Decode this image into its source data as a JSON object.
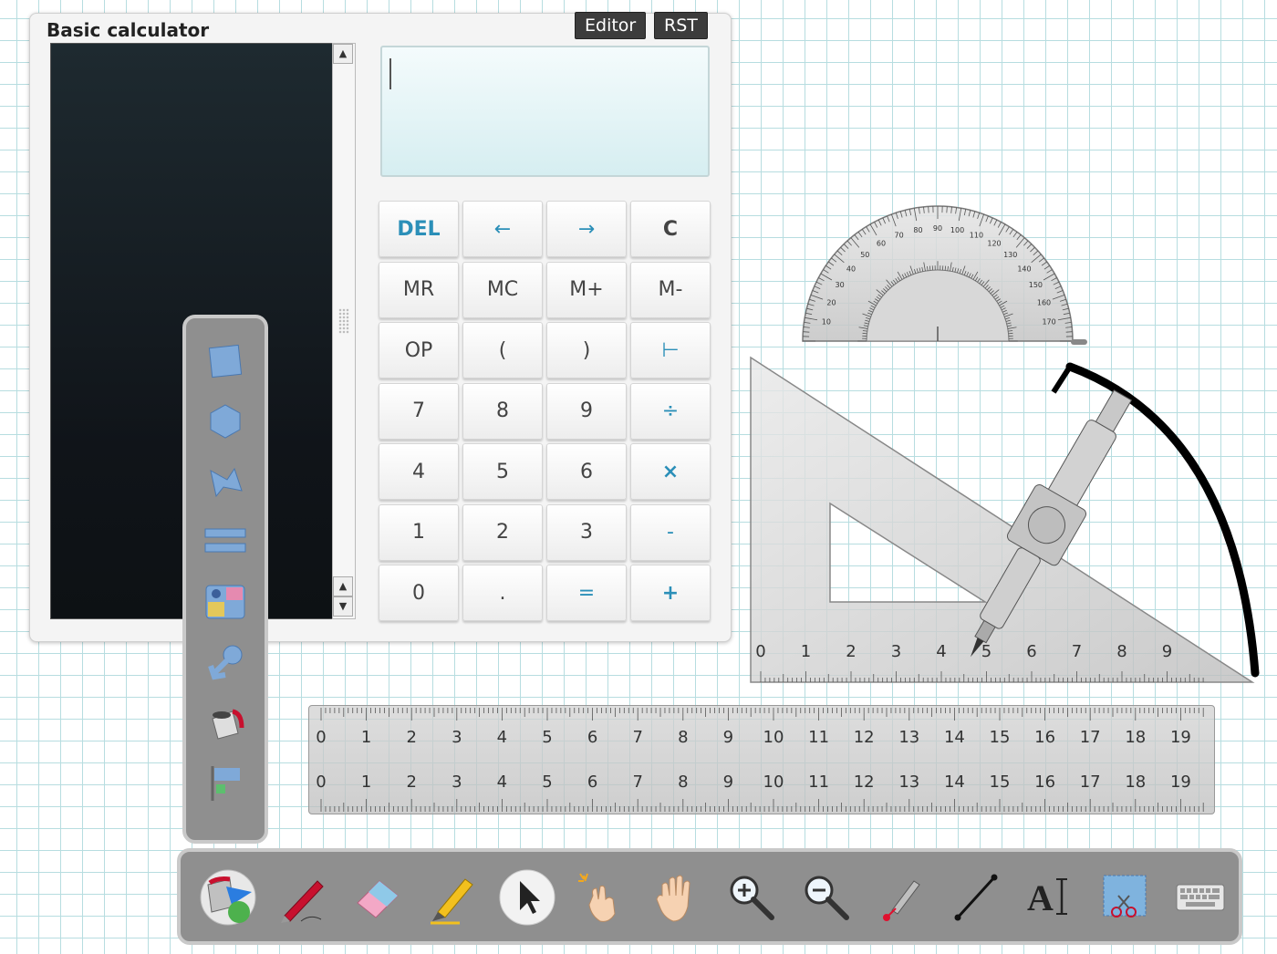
{
  "calculator": {
    "title": "Basic calculator",
    "editor_button": "Editor",
    "rst_button": "RST",
    "keys": [
      {
        "label": "DEL",
        "style": "accent bold"
      },
      {
        "label": "←",
        "style": "accent"
      },
      {
        "label": "→",
        "style": "accent"
      },
      {
        "label": "C",
        "style": "bold"
      },
      {
        "label": "MR",
        "style": ""
      },
      {
        "label": "MC",
        "style": ""
      },
      {
        "label": "M+",
        "style": ""
      },
      {
        "label": "M-",
        "style": ""
      },
      {
        "label": "OP",
        "style": ""
      },
      {
        "label": "(",
        "style": ""
      },
      {
        "label": ")",
        "style": ""
      },
      {
        "label": "⊢",
        "style": "accent"
      },
      {
        "label": "7",
        "style": ""
      },
      {
        "label": "8",
        "style": ""
      },
      {
        "label": "9",
        "style": ""
      },
      {
        "label": "÷",
        "style": "accent"
      },
      {
        "label": "4",
        "style": ""
      },
      {
        "label": "5",
        "style": ""
      },
      {
        "label": "6",
        "style": ""
      },
      {
        "label": "×",
        "style": "accent bold"
      },
      {
        "label": "1",
        "style": ""
      },
      {
        "label": "2",
        "style": ""
      },
      {
        "label": "3",
        "style": ""
      },
      {
        "label": "-",
        "style": "accent"
      },
      {
        "label": "0",
        "style": ""
      },
      {
        "label": "",
        "style": ""
      },
      {
        "label": ".",
        "style": ""
      },
      {
        "label": "=",
        "style": "accent"
      },
      {
        "label": "+",
        "style": "accent bold"
      }
    ]
  },
  "shape_palette": {
    "items": [
      "rectangle-icon",
      "hexagon-icon",
      "polygon-icon",
      "lines-icon",
      "pattern-fill-icon",
      "arrow-shape-icon",
      "paint-bucket-icon",
      "flag-icon"
    ]
  },
  "toolbar": {
    "tools": [
      "colors-icon",
      "pen-icon",
      "eraser-icon",
      "highlighter-icon",
      "select-icon",
      "magic-pointer-icon",
      "pan-hand-icon",
      "zoom-in-icon",
      "zoom-out-icon",
      "laser-pointer-icon",
      "line-icon",
      "text-icon",
      "screen-capture-icon",
      "keyboard-icon"
    ]
  },
  "ruler": {
    "top_scale": [
      "0",
      "1",
      "2",
      "3",
      "4",
      "5",
      "6",
      "7",
      "8",
      "9",
      "10",
      "11",
      "12",
      "13",
      "14",
      "15",
      "16",
      "17",
      "18",
      "19"
    ],
    "bottom_scale": [
      "0",
      "1",
      "2",
      "3",
      "4",
      "5",
      "6",
      "7",
      "8",
      "9",
      "10",
      "11",
      "12",
      "13",
      "14",
      "15",
      "16",
      "17",
      "18",
      "19"
    ]
  },
  "set_square": {
    "scale": [
      "0",
      "1",
      "2",
      "3",
      "4",
      "5",
      "6",
      "7",
      "8",
      "9"
    ]
  },
  "protractor": {
    "outer_scale": [
      "10",
      "20",
      "30",
      "40",
      "50",
      "60",
      "70",
      "80",
      "90",
      "100",
      "110",
      "120",
      "130",
      "140",
      "150",
      "160",
      "170"
    ]
  },
  "colors": {
    "accent": "#2b8fb8",
    "grid": "#b7dde0",
    "toolbar_bg": "#8f8f8f",
    "toolbar_border": "#c9c9c9"
  }
}
